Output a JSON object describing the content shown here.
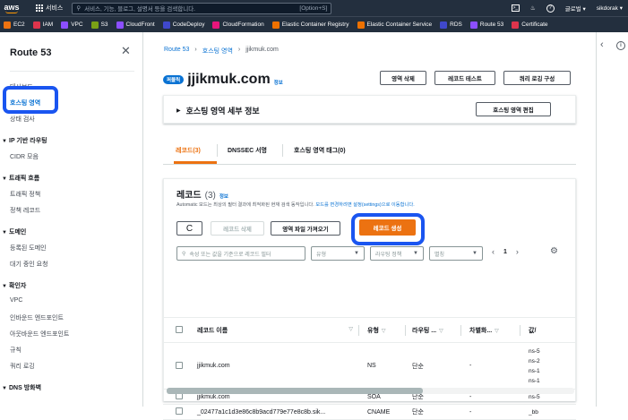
{
  "topnav": {
    "logo": "aws",
    "services_label": "서비스",
    "search_placeholder": "서비스, 기능, 블로그, 설명서 등을 검색합니다.",
    "search_shortcut": "[Option+S]",
    "region": "글로벌 ▾",
    "user": "sikdorak ▾"
  },
  "favorites": [
    {
      "label": "EC2",
      "color": "#ec7211"
    },
    {
      "label": "IAM",
      "color": "#dd344c"
    },
    {
      "label": "VPC",
      "color": "#8c4fff"
    },
    {
      "label": "S3",
      "color": "#7aa116"
    },
    {
      "label": "CloudFront",
      "color": "#8c4fff"
    },
    {
      "label": "CodeDeploy",
      "color": "#3f48cc"
    },
    {
      "label": "CloudFormation",
      "color": "#e7157b"
    },
    {
      "label": "Elastic Container Registry",
      "color": "#ed7100"
    },
    {
      "label": "Elastic Container Service",
      "color": "#ed7100"
    },
    {
      "label": "RDS",
      "color": "#3f48cc"
    },
    {
      "label": "Route 53",
      "color": "#8c4fff"
    },
    {
      "label": "Certificate",
      "color": "#dd344c"
    }
  ],
  "sidebar": {
    "title": "Route 53",
    "items": [
      {
        "label": "대시보드",
        "type": "item"
      },
      {
        "label": "호스팅 영역",
        "type": "active"
      },
      {
        "label": "상태 검사",
        "type": "item"
      },
      {
        "label": "IP 기반 라우팅",
        "type": "section"
      },
      {
        "label": "CIDR 모음",
        "type": "item"
      },
      {
        "label": "트래픽 흐름",
        "type": "section"
      },
      {
        "label": "트래픽 정책",
        "type": "item"
      },
      {
        "label": "정책 레코드",
        "type": "item"
      },
      {
        "label": "도메인",
        "type": "section"
      },
      {
        "label": "등록된 도메인",
        "type": "item"
      },
      {
        "label": "대기 중인 요청",
        "type": "item"
      },
      {
        "label": "확인자",
        "type": "section"
      },
      {
        "label": "VPC",
        "type": "item"
      },
      {
        "label": "인바운드 엔드포인트",
        "type": "item"
      },
      {
        "label": "아웃바운드 엔드포인트",
        "type": "item"
      },
      {
        "label": "규칙",
        "type": "item"
      },
      {
        "label": "쿼리 로깅",
        "type": "item"
      },
      {
        "label": "DNS 방화벽",
        "type": "section"
      }
    ]
  },
  "breadcrumb": [
    "Route 53",
    "호스팅 영역",
    "jjikmuk.com"
  ],
  "header": {
    "badge": "퍼블릭",
    "title": "jjikmuk.com",
    "info": "정보",
    "buttons": {
      "delete": "영역 삭제",
      "test": "레코드 테스트",
      "logging": "쿼리 로깅 구성"
    }
  },
  "details": {
    "title": "호스팅 영역 세부 정보",
    "edit_button": "호스팅 영역 편집"
  },
  "tabs": [
    "레코드(3)",
    "DNSSEC 서명",
    "호스팅 영역 태그(0)"
  ],
  "records": {
    "title": "레코드",
    "count": "(3)",
    "info": "정보",
    "description": "Automatic 모드는 최상의 필터 결과에 최적화된 현재 검색 동작입니다. ",
    "description_link": "모드를 변경하려면 설정(settings)으로 이동합니다.",
    "buttons": {
      "refresh": "C",
      "delete": "레코드 삭제",
      "import": "영역 파일 가져오기",
      "create": "레코드 생성"
    },
    "filter_placeholder": "속성 또는 값을 기준으로 레코드 필터",
    "type_filter": "유형",
    "routing_filter": "라우팅 정책",
    "alias_filter": "별칭",
    "page": "1",
    "columns": [
      "레코드 이름",
      "유형",
      "라우팅 ...",
      "차별화...",
      "값/"
    ],
    "rows": [
      {
        "name": "jjikmuk.com",
        "type": "NS",
        "routing": "단순",
        "diff": "-",
        "value": [
          "ns-5",
          "ns-2",
          "ns-1",
          "ns-1"
        ]
      },
      {
        "name": "jjikmuk.com",
        "type": "SOA",
        "routing": "단순",
        "diff": "-",
        "value": [
          "ns-5"
        ]
      },
      {
        "name": "_02477a1c1d3e86c8b9acd779e77e8c8b.sik...",
        "type": "CNAME",
        "routing": "단순",
        "diff": "-",
        "value": [
          "_bb"
        ]
      }
    ]
  }
}
